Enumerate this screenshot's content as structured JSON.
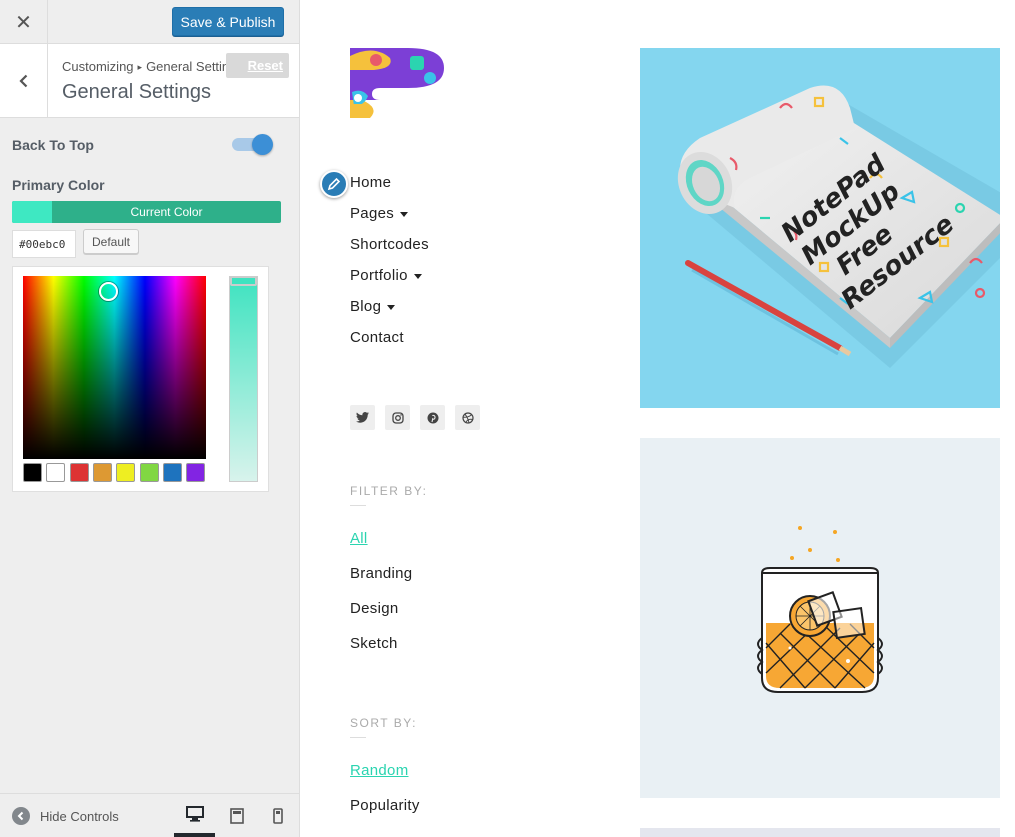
{
  "customizer": {
    "close_label": "✕",
    "save_label": "Save & Publish",
    "breadcrumb_root": "Customizing",
    "breadcrumb_separator": "▸",
    "breadcrumb_section": "General Settings",
    "section_title": "General Settings",
    "reset_label": "Reset",
    "back_to_top_label": "Back To Top",
    "back_to_top_enabled": true,
    "primary_color_label": "Primary Color",
    "current_color_label": "Current Color",
    "current_color_hex": "#00ebc0",
    "default_label": "Default",
    "palette": [
      "#000000",
      "#ffffff",
      "#dd3333",
      "#dd9933",
      "#eeee22",
      "#81d742",
      "#1e73be",
      "#8224e3"
    ],
    "hide_controls_label": "Hide Controls",
    "devices": [
      "desktop-icon",
      "tablet-icon",
      "mobile-icon"
    ],
    "active_device": "desktop"
  },
  "preview": {
    "nav": [
      {
        "label": "Home",
        "has_submenu": false
      },
      {
        "label": "Pages",
        "has_submenu": true
      },
      {
        "label": "Shortcodes",
        "has_submenu": false
      },
      {
        "label": "Portfolio",
        "has_submenu": true
      },
      {
        "label": "Blog",
        "has_submenu": true
      },
      {
        "label": "Contact",
        "has_submenu": false
      }
    ],
    "social_icons": [
      "twitter-icon",
      "instagram-icon",
      "pinterest-icon",
      "dribbble-icon"
    ],
    "filter_label": "FILTER BY:",
    "filters": [
      "All",
      "Branding",
      "Design",
      "Sketch"
    ],
    "active_filter": "All",
    "sort_label": "SORT BY:",
    "sorts": [
      "Random",
      "Popularity"
    ],
    "active_sort": "Random",
    "notepad_lines": [
      "NotePad",
      "MockUp",
      "Free",
      "Resource"
    ],
    "accent_color": "#2bd4b0"
  }
}
